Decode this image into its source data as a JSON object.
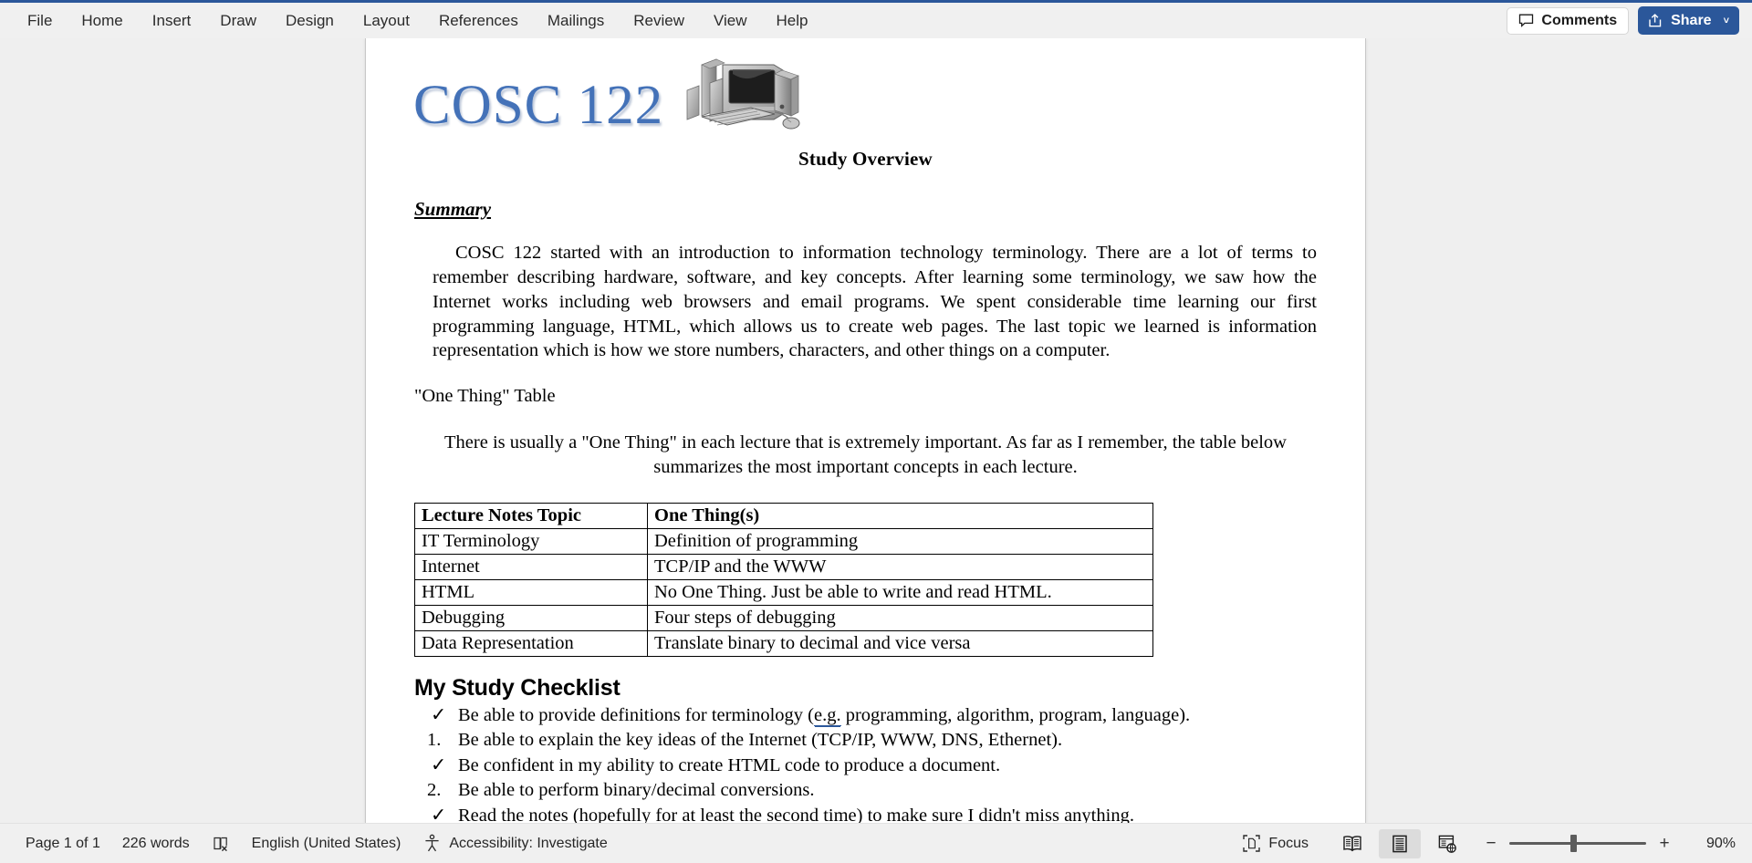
{
  "app": {
    "accent_color": "#2b579a",
    "ribbon_bg": "#f0f0f0"
  },
  "ribbon": {
    "tabs": [
      {
        "label": "File"
      },
      {
        "label": "Home"
      },
      {
        "label": "Insert"
      },
      {
        "label": "Draw"
      },
      {
        "label": "Design"
      },
      {
        "label": "Layout"
      },
      {
        "label": "References"
      },
      {
        "label": "Mailings"
      },
      {
        "label": "Review"
      },
      {
        "label": "View"
      },
      {
        "label": "Help"
      }
    ],
    "comments_label": "Comments",
    "comments_icon": "comment-bubble-icon",
    "share_label": "Share",
    "share_icon": "share-arrow-icon",
    "share_caret": "˅"
  },
  "document": {
    "logo_text": "COSC 122",
    "logo_color": "#4472b8",
    "logo_image": "desktop-computer-clipart",
    "title": "Study Overview",
    "summary_heading": "Summary",
    "summary_paragraph": "COSC 122 started with an introduction to information technology terminology.  There are a lot of terms to remember describing hardware, software, and key concepts.  After learning some terminology, we saw how the Internet works including web browsers and email programs.  We spent considerable time learning our first programming language, HTML, which allows us to create web pages.  The last topic we learned is information representation which is how we store numbers, characters, and other things on a computer.",
    "one_thing_label": "\"One Thing\" Table",
    "table_intro": "There is usually a \"One Thing\" in each lecture that is extremely important.  As far as I remember, the table below summarizes the most important concepts in each lecture.",
    "table": {
      "headers": [
        "Lecture Notes Topic",
        "One Thing(s)"
      ],
      "rows": [
        [
          "IT Terminology",
          "Definition of programming"
        ],
        [
          "Internet",
          "TCP/IP and the WWW"
        ],
        [
          "HTML",
          "No One Thing. Just be able to write and read HTML."
        ],
        [
          "Debugging",
          "Four steps of debugging"
        ],
        [
          "Data Representation",
          "Translate binary to decimal and vice versa"
        ]
      ]
    },
    "checklist_heading": "My Study Checklist",
    "checklist": [
      {
        "marker": "✓",
        "marker_type": "check",
        "text_before": "Be able to provide definitions for terminology (",
        "flagged": "e.g.",
        "text_after": " programming, algorithm, program, language)."
      },
      {
        "marker": "1.",
        "marker_type": "number",
        "text": "Be able to explain the key ideas of the Internet (TCP/IP, WWW, DNS, Ethernet)."
      },
      {
        "marker": "✓",
        "marker_type": "check",
        "text": "Be confident in my ability to create HTML code to produce a document."
      },
      {
        "marker": "2.",
        "marker_type": "number",
        "text": "Be able to perform binary/decimal conversions."
      },
      {
        "marker": "✓",
        "marker_type": "check",
        "text": "Read the notes (hopefully for at least the second time) to make sure I didn't miss anything."
      }
    ]
  },
  "statusbar": {
    "page_label": "Page 1 of 1",
    "word_count": "226 words",
    "proofing_icon": "proofing-errors-icon",
    "language": "English (United States)",
    "accessibility_icon": "accessibility-icon",
    "accessibility": "Accessibility: Investigate",
    "focus_icon": "focus-mode-icon",
    "focus_label": "Focus",
    "view_read_icon": "read-mode-icon",
    "view_print_icon": "print-layout-icon",
    "view_web_icon": "web-layout-icon",
    "zoom_out": "−",
    "zoom_in": "+",
    "zoom_level": "90%"
  }
}
